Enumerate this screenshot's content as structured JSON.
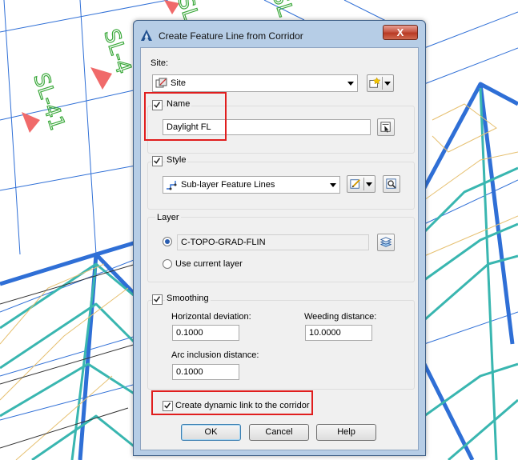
{
  "background": {
    "labels": [
      "SL-41",
      "SL-4",
      "SL-4",
      "SL"
    ],
    "colors": {
      "linework": "#2f6fd6",
      "teal": "#39b6b0",
      "marker": "#f06a6a",
      "label": "#3aa83a",
      "contour": "#e6c070"
    }
  },
  "dialog": {
    "title": "Create Feature Line from Corridor",
    "close_label": "X",
    "site": {
      "label": "Site:",
      "value": "Site"
    },
    "name": {
      "label": "Name",
      "checked": true,
      "value": "Daylight FL"
    },
    "style": {
      "label": "Style",
      "checked": true,
      "value": "Sub-layer Feature Lines"
    },
    "layer": {
      "label": "Layer",
      "value": "C-TOPO-GRAD-FLIN",
      "use_current_label": "Use current layer"
    },
    "smoothing": {
      "label": "Smoothing",
      "checked": true,
      "horizontal_label": "Horizontal deviation:",
      "horizontal_value": "0.1000",
      "weeding_label": "Weeding distance:",
      "weeding_value": "10.0000",
      "arc_label": "Arc inclusion distance:",
      "arc_value": "0.1000"
    },
    "dynamic_link": {
      "label": "Create dynamic link to the corridor",
      "checked": true
    },
    "buttons": {
      "ok": "OK",
      "cancel": "Cancel",
      "help": "Help"
    }
  }
}
